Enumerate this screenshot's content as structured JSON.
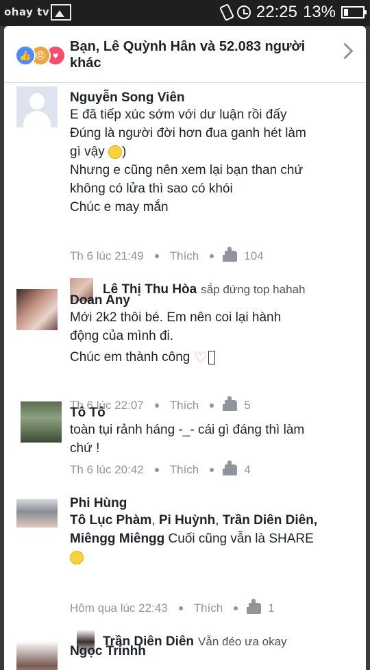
{
  "status": {
    "watermark": "ohay tv",
    "time": "22:25",
    "battery": "13%"
  },
  "header": {
    "reactions_text": "Bạn, Lê Quỳnh Hân và 52.083 người khác"
  },
  "comments": [
    {
      "name": "Nguyễn Song Viên",
      "lines": [
        "E đã tiếp xúc sớm với dư luận rồi đấy",
        "Đúng là người đời hơn đua ganh hét làm",
        "gì vậy",
        ")",
        "Nhưng e cũng nên xem lại bạn than chứ",
        "không có lửa thì sao có khói",
        "Chúc e may mắn"
      ],
      "time": "Th 6 lúc 21:49",
      "like_label": "Thích",
      "likes": "104",
      "reply": {
        "name": "Lê Thị Thu Hòa",
        "text": "sắp đứng top hahah"
      }
    },
    {
      "name": "Doan Any",
      "lines": [
        "Mới 2k2 thôi bé. Em nên coi lại hành",
        "động của mình đi.",
        "Chúc em thành công"
      ],
      "time": "Th 6 lúc 22:07",
      "like_label": "Thích",
      "likes": "5"
    },
    {
      "name": "Tô Tô",
      "lines": [
        "toàn tụi rảnh háng -_- cái gì đáng thì làm",
        "chứ !"
      ],
      "time": "Th 6 lúc 20:42",
      "like_label": "Thích",
      "likes": "4"
    },
    {
      "name": "Phi Hùng",
      "tags": [
        "Tô Lục Phàm",
        "Pi Huỳnh",
        "Trần Diên Diên,",
        "Miêngg Miêngg"
      ],
      "tail": "Cuối cũng vẫn là SHARE",
      "time": "Hôm qua lúc 22:43",
      "like_label": "Thích",
      "likes": "1",
      "reply": {
        "name": "Trần Diên Diên",
        "text": "Vẫn đéo ưa okay"
      }
    },
    {
      "name": "Ngọc Trinhh"
    }
  ]
}
